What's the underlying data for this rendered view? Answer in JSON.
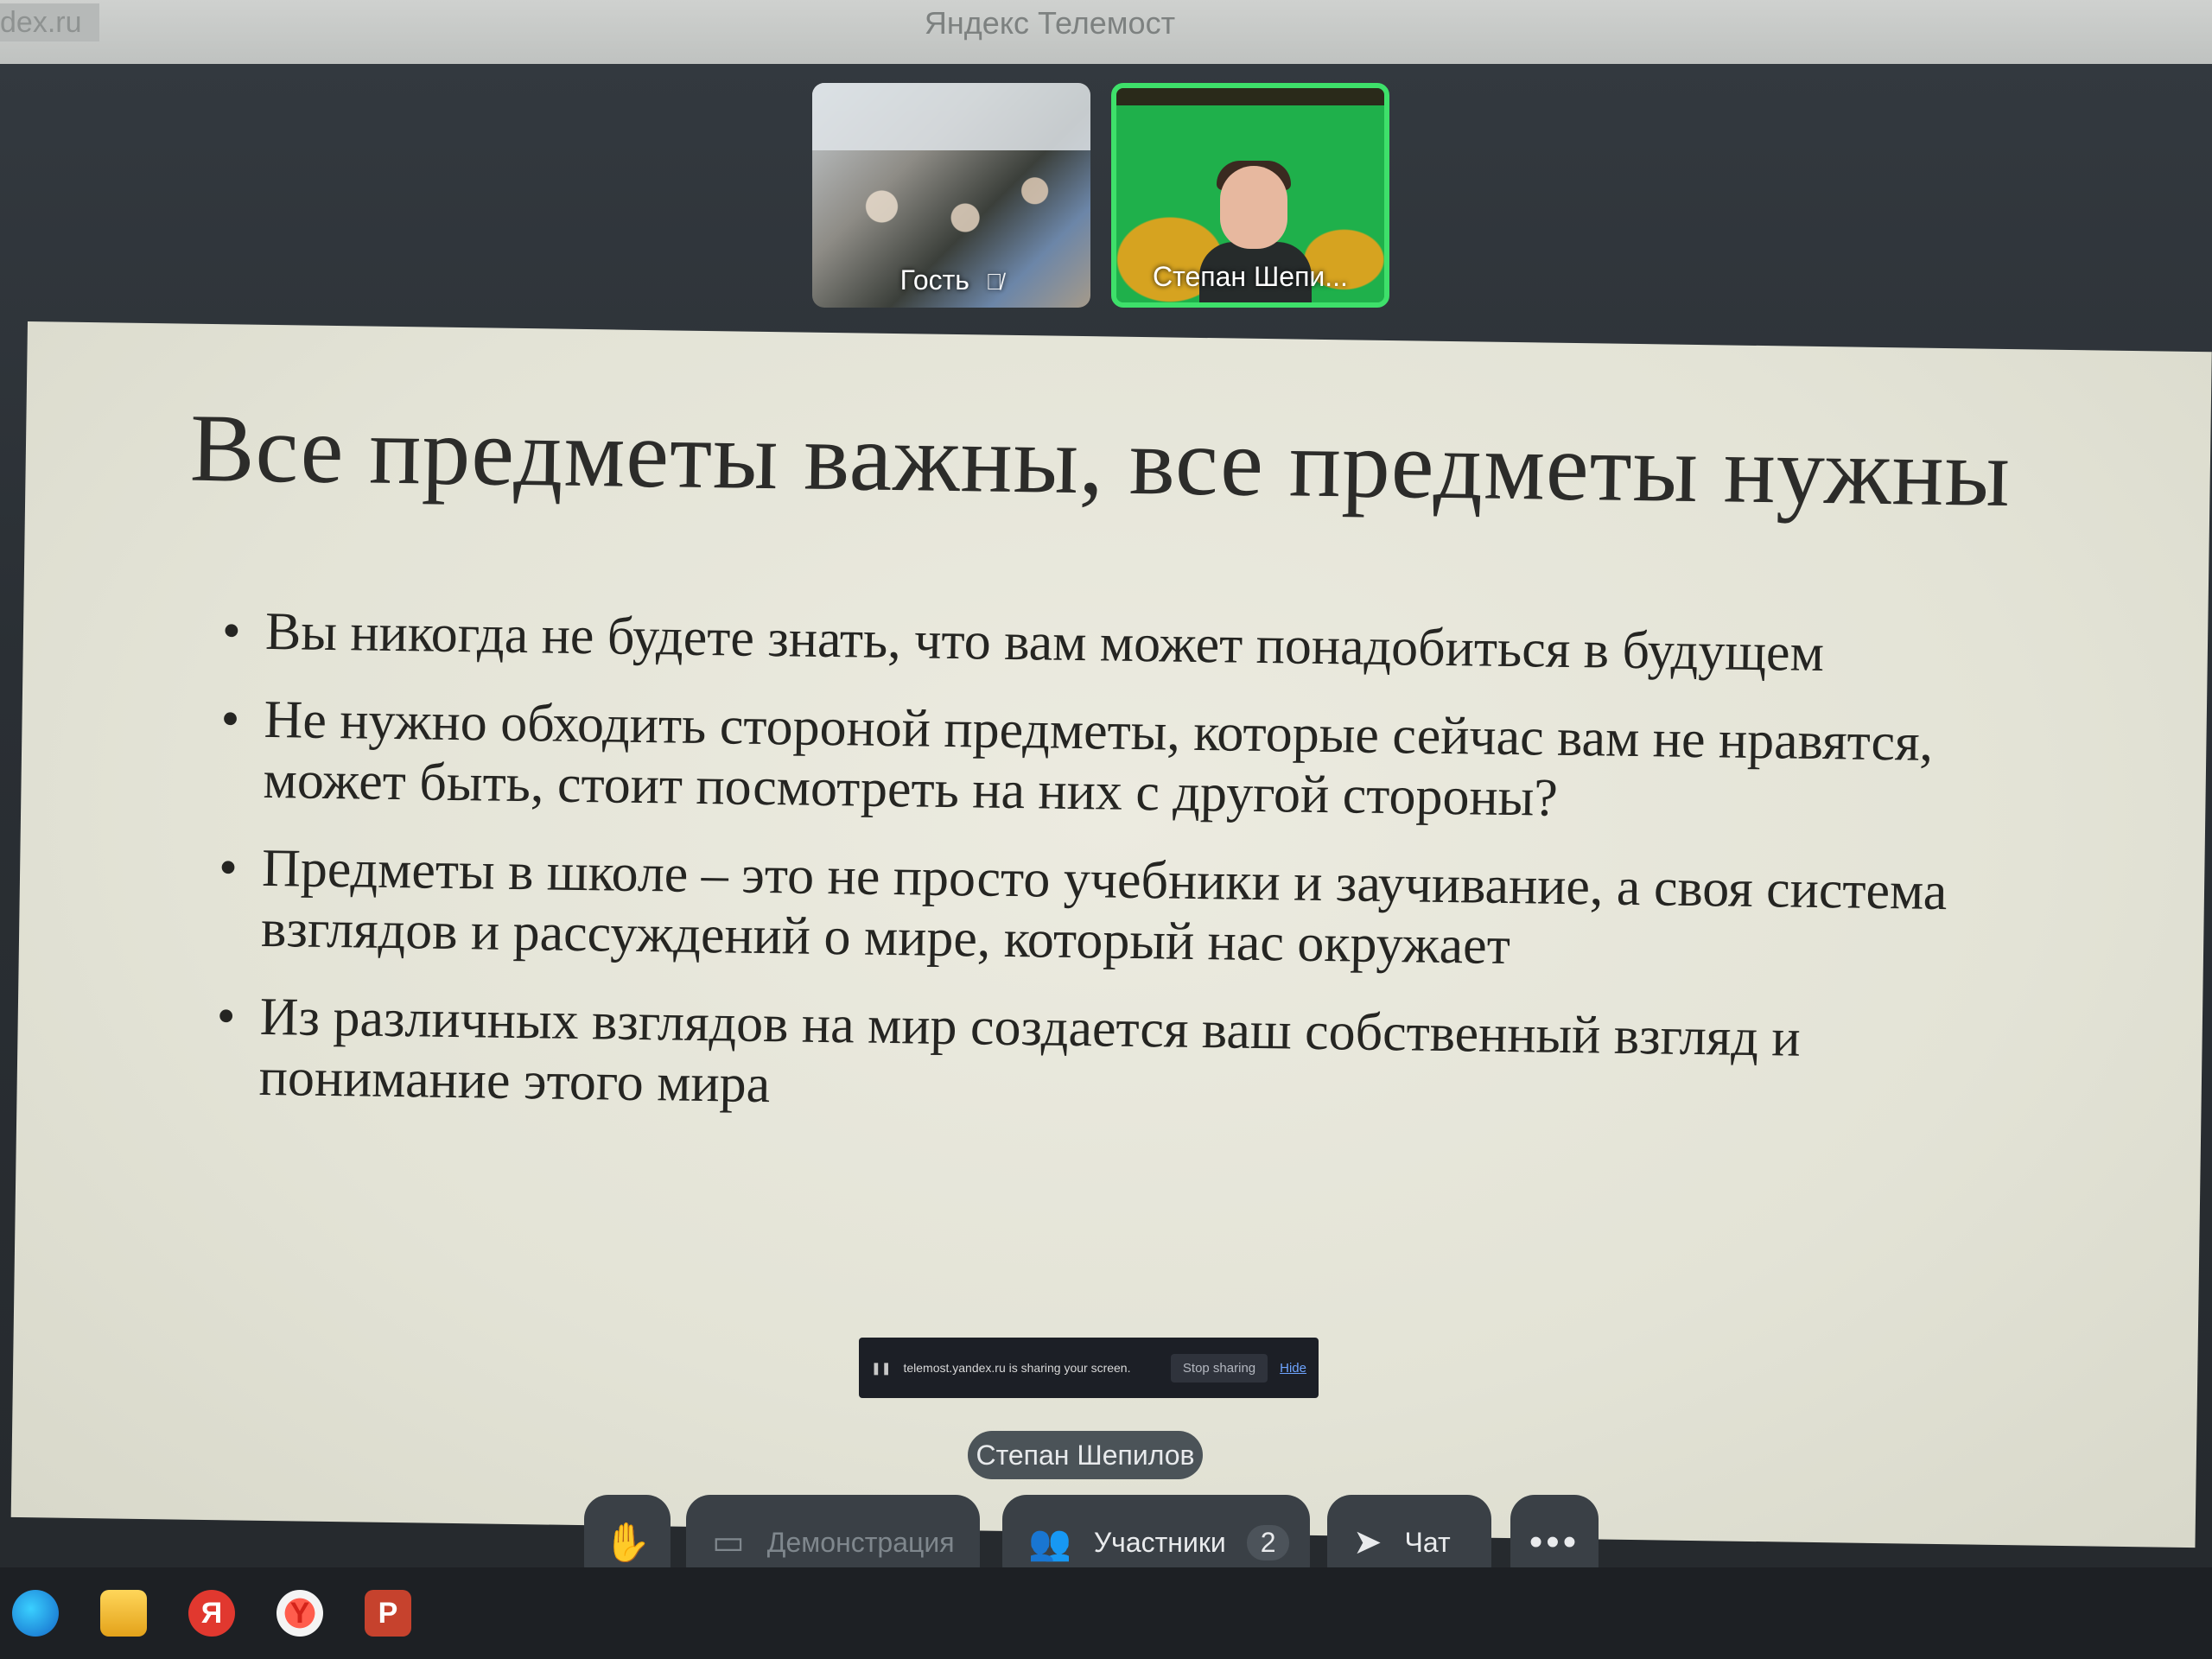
{
  "window": {
    "url_fragment": "dex.ru",
    "title": "Яндекс Телемост"
  },
  "participants": [
    {
      "name": "Гость",
      "muted": true,
      "mic_icon": "mic-off-icon"
    },
    {
      "name": "Степан Шепи...",
      "speaking": true
    }
  ],
  "slide": {
    "title": "Все предметы важны, все предметы нужны",
    "bullets": [
      "Вы никогда не будете знать, что вам может понадобиться в будущем",
      "Не нужно обходить стороной предметы, которые сейчас вам не нравятся, может быть, стоит посмотреть на них с другой стороны?",
      "Предметы в школе – это не просто учебники и заучивание, а своя система взглядов и рассуждений о мире, который нас окружает",
      "Из различных взглядов на мир создается ваш собственный взгляд и понимание этого мира"
    ]
  },
  "share_notice": {
    "pause_icon": "pause-icon",
    "message": "telemost.yandex.ru is sharing your screen.",
    "stop_label": "Stop sharing",
    "hide_label": "Hide"
  },
  "speaker_chip": "Степан Шепилов",
  "controls": {
    "hand_icon": "raise-hand-icon",
    "demo_label": "Демонстрация",
    "participants_label": "Участники",
    "participants_count": "2",
    "chat_label": "Чат",
    "more_icon": "more-icon"
  },
  "taskbar": {
    "icons": [
      "edge-icon",
      "file-explorer-icon",
      "yandex-icon",
      "yandex-browser-icon",
      "powerpoint-icon"
    ],
    "yandex_glyph": "Я",
    "ppt_glyph": "P"
  },
  "colors": {
    "speaking_border": "#3ee06a",
    "control_bg": "#3a4046",
    "slide_bg": "#e3e3d6"
  }
}
